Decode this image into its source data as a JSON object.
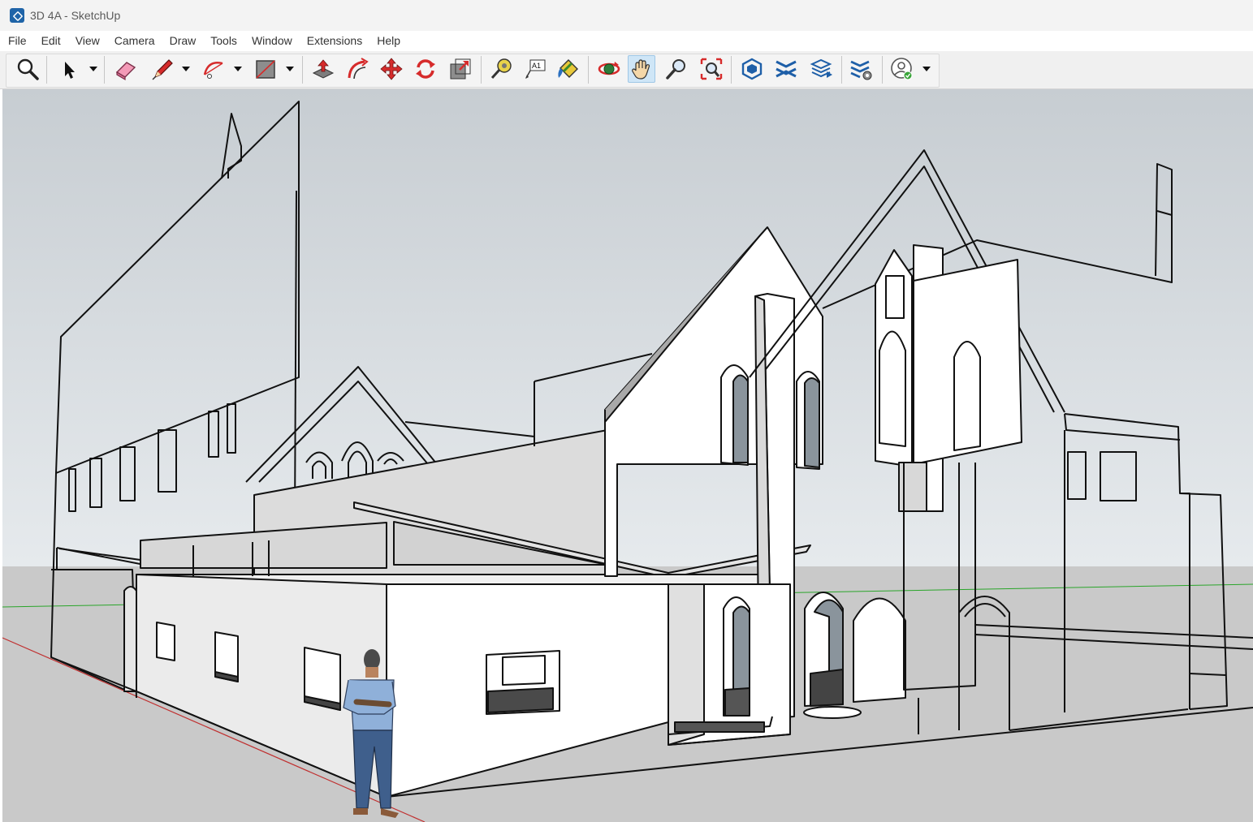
{
  "window": {
    "title": "3D 4A - SketchUp",
    "app_icon": "sketchup-logo-icon"
  },
  "menu": [
    "File",
    "Edit",
    "View",
    "Camera",
    "Draw",
    "Tools",
    "Window",
    "Extensions",
    "Help"
  ],
  "toolbar": {
    "tools": [
      {
        "name": "search-tool",
        "icon": "magnifier-icon"
      },
      {
        "name": "select-tool",
        "icon": "arrow-cursor-icon"
      },
      {
        "name": "eraser-tool",
        "icon": "eraser-icon"
      },
      {
        "name": "pencil-tool",
        "icon": "pencil-icon"
      },
      {
        "name": "arc-tool",
        "icon": "arc-icon"
      },
      {
        "name": "rectangle-tool",
        "icon": "rectangle-icon"
      },
      {
        "name": "push-pull-tool",
        "icon": "push-pull-icon"
      },
      {
        "name": "offset-tool",
        "icon": "offset-icon"
      },
      {
        "name": "move-tool",
        "icon": "move-icon"
      },
      {
        "name": "rotate-tool",
        "icon": "rotate-icon"
      },
      {
        "name": "scale-tool",
        "icon": "scale-icon"
      },
      {
        "name": "tape-measure-tool",
        "icon": "tape-measure-icon"
      },
      {
        "name": "text-tool",
        "icon": "text-icon",
        "label": "A1"
      },
      {
        "name": "paint-bucket-tool",
        "icon": "paint-bucket-icon"
      },
      {
        "name": "orbit-tool",
        "icon": "orbit-icon"
      },
      {
        "name": "pan-tool",
        "icon": "hand-icon",
        "active": true
      },
      {
        "name": "zoom-tool",
        "icon": "zoom-icon"
      },
      {
        "name": "zoom-extents-tool",
        "icon": "zoom-extents-icon"
      },
      {
        "name": "3d-warehouse-tool",
        "icon": "warehouse-icon"
      },
      {
        "name": "extension-warehouse-tool",
        "icon": "extension-warehouse-icon"
      },
      {
        "name": "layout-tool",
        "icon": "layout-icon"
      },
      {
        "name": "extension-manager-tool",
        "icon": "extension-manager-icon"
      },
      {
        "name": "account-tool",
        "icon": "user-account-icon"
      }
    ]
  },
  "colors": {
    "sky": "#cdd3d8",
    "ground": "#c9c9c9",
    "axis_red": "#c03030",
    "axis_green": "#2aa52a",
    "active_tool": "#cfe6f7"
  }
}
